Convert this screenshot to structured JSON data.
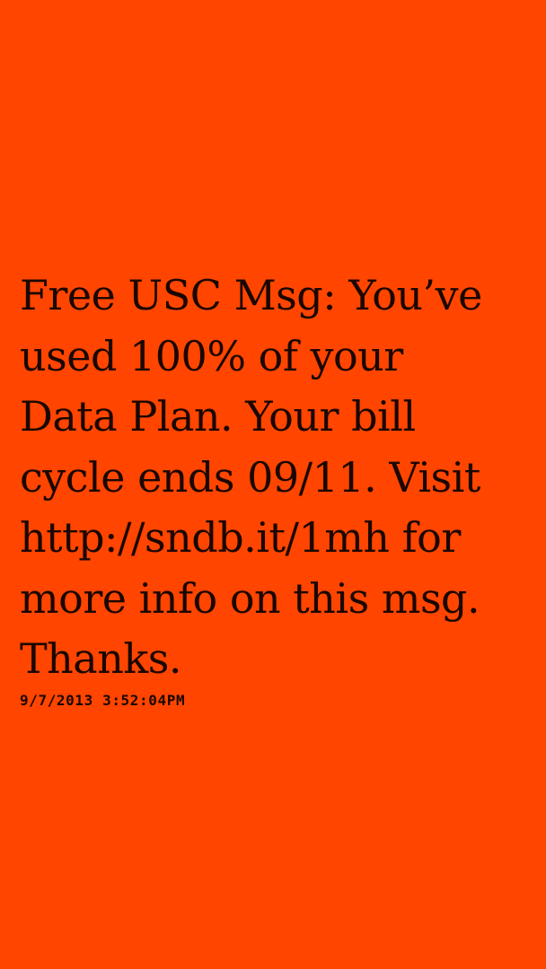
{
  "message": {
    "text": "Free USC Msg: You’ve\nused 100% of your\nData Plan. Your bill\ncycle ends 09/11. Visit\nhttp://sndb.it/1mh for\nmore info on this msg.\nThanks.",
    "timestamp": "9/7/2013 3:52:04PM"
  },
  "colors": {
    "background": "#ff4500",
    "text": "#1a0700"
  }
}
